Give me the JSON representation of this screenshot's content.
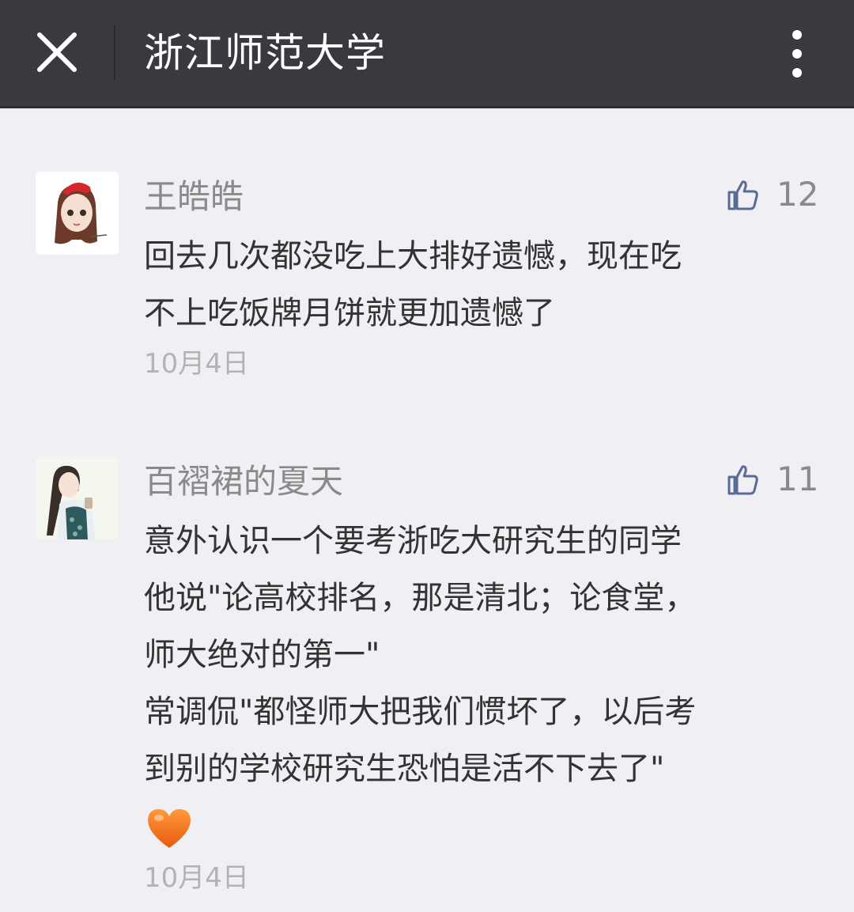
{
  "header": {
    "title": "浙江师范大学",
    "close_icon": "close-icon",
    "more_icon": "more-vertical-icon"
  },
  "comments": [
    {
      "author": "王皓皓",
      "likes": "12",
      "lines": [
        "回去几次都没吃上大排好遗憾，现在吃",
        "不上吃饭牌月饼就更加遗憾了"
      ],
      "date": "10月4日"
    },
    {
      "author": "百褶裙的夏天",
      "likes": "11",
      "lines": [
        "意外认识一个要考浙吃大研究生的同学",
        "他说\"论高校排名，那是清北；论食堂，",
        "师大绝对的第一\"",
        "常调侃\"都怪师大把我们惯坏了，以后考",
        "到别的学校研究生恐怕是活不下去了\""
      ],
      "emoji": "orange-heart",
      "date": "10月4日"
    }
  ],
  "colors": {
    "header_bg": "#393a3f",
    "page_bg": "#efeff4",
    "thumb_icon": "#576b95",
    "heart": "#f37021"
  }
}
